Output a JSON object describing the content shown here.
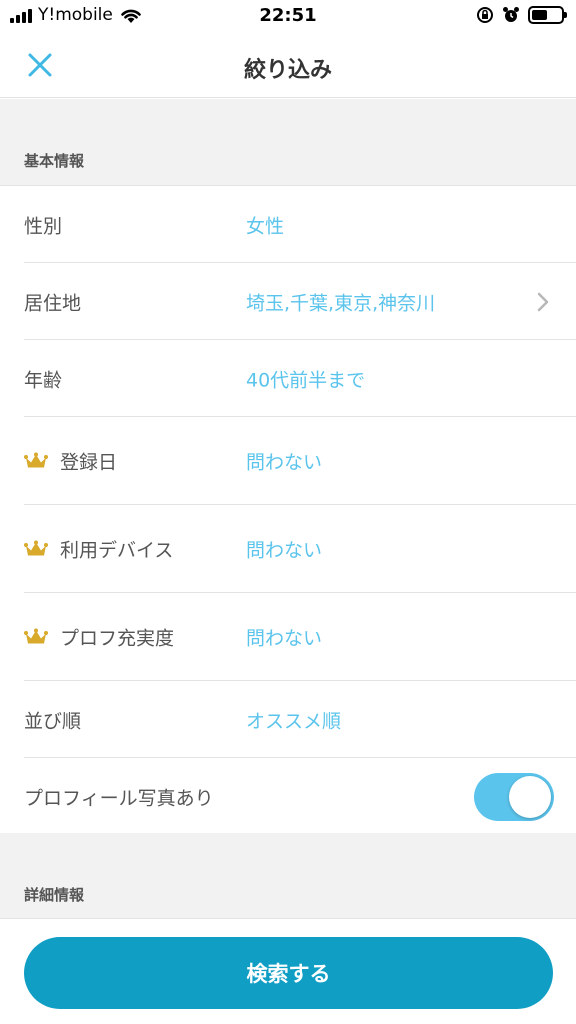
{
  "status_bar": {
    "carrier": "Y!mobile",
    "time": "22:51"
  },
  "nav": {
    "title": "絞り込み",
    "close_icon": "close-icon"
  },
  "sections": {
    "basic": "基本情報",
    "detail": "詳細情報"
  },
  "filters": [
    {
      "label": "性別",
      "value": "女性",
      "premium": false,
      "chevron": false
    },
    {
      "label": "居住地",
      "value": "埼玉,千葉,東京,神奈川",
      "premium": false,
      "chevron": true
    },
    {
      "label": "年齢",
      "value": "40代前半まで",
      "premium": false,
      "chevron": false
    },
    {
      "label": "登録日",
      "value": "問わない",
      "premium": true,
      "chevron": false
    },
    {
      "label": "利用デバイス",
      "value": "問わない",
      "premium": true,
      "chevron": false
    },
    {
      "label": "プロフ充実度",
      "value": "問わない",
      "premium": true,
      "chevron": false
    },
    {
      "label": "並び順",
      "value": "オススメ順",
      "premium": false,
      "chevron": false
    }
  ],
  "photo_toggle": {
    "label": "プロフィール写真あり",
    "enabled": true
  },
  "footer": {
    "search_label": "検索する"
  },
  "colors": {
    "accent": "#5bc4ec",
    "button": "#109ec5",
    "crown": "#d9a92b"
  }
}
